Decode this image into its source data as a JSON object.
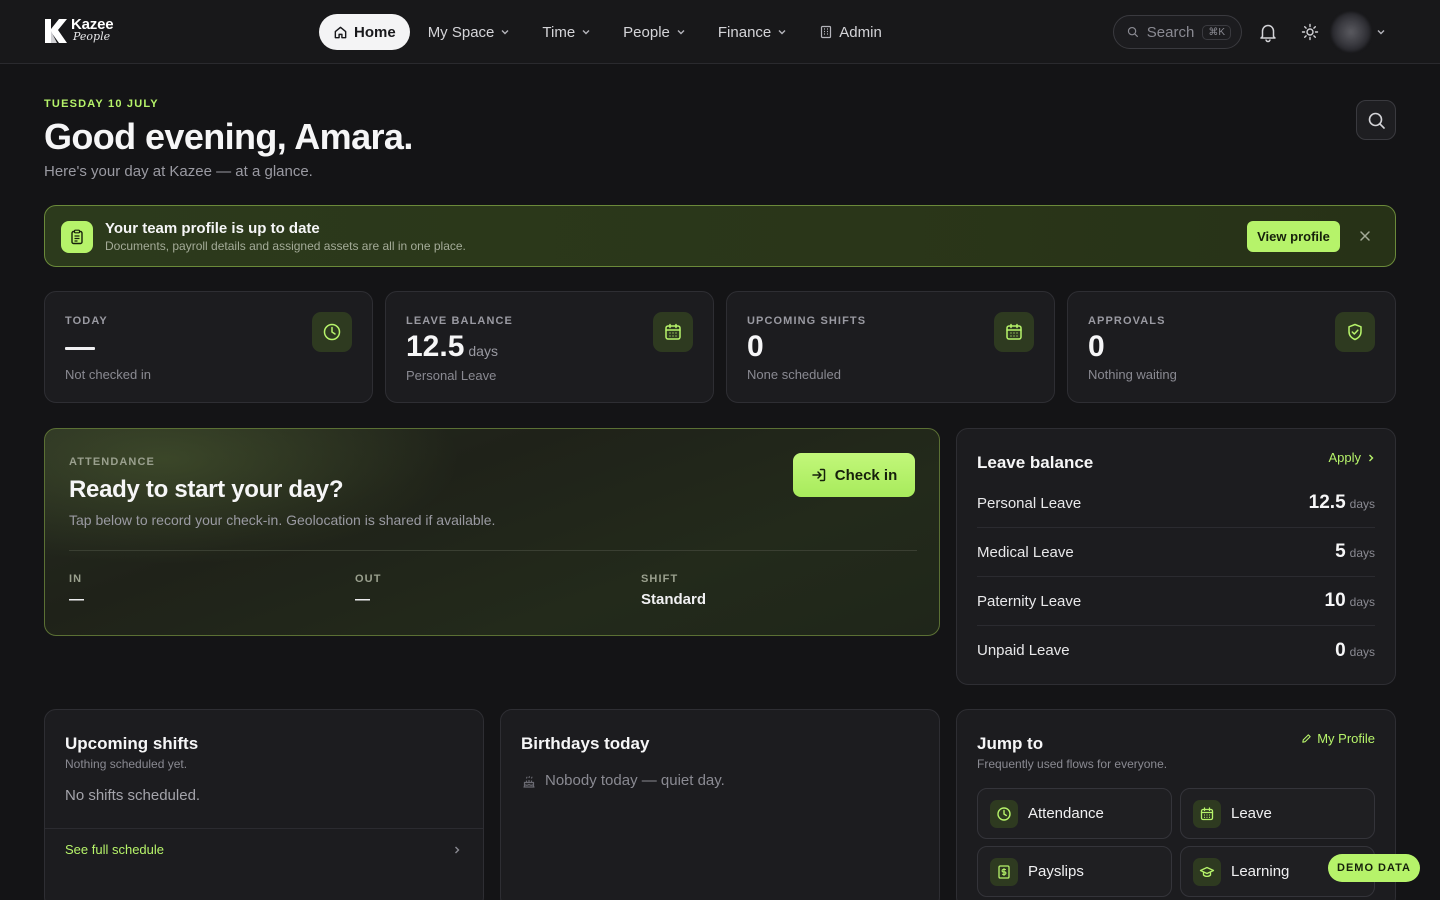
{
  "brand": {
    "name_line1": "Kazee",
    "name_line2": "People"
  },
  "nav": {
    "items": [
      {
        "label": "Home"
      },
      {
        "label": "My Space"
      },
      {
        "label": "Time"
      },
      {
        "label": "People"
      },
      {
        "label": "Finance"
      },
      {
        "label": "Admin"
      }
    ],
    "search_label": "Search",
    "search_shortcut": "⌘K"
  },
  "hero": {
    "date": "TUESDAY 10 JULY",
    "greeting": "Good evening, Amara.",
    "subtitle": "Here's your day at Kazee — at a glance."
  },
  "banner": {
    "title": "Your team profile is up to date",
    "text": "Documents, payroll details and assigned assets are all in one place.",
    "button": "View profile"
  },
  "stats": [
    {
      "label": "TODAY",
      "value": "",
      "unit": "",
      "note": "Not checked in",
      "icon": "clock-icon"
    },
    {
      "label": "LEAVE BALANCE",
      "value": "12.5",
      "unit": "days",
      "note": "Personal Leave",
      "icon": "calendar-icon"
    },
    {
      "label": "UPCOMING SHIFTS",
      "value": "0",
      "unit": "",
      "note": "None scheduled",
      "icon": "calendar-icon"
    },
    {
      "label": "APPROVALS",
      "value": "0",
      "unit": "",
      "note": "Nothing waiting",
      "icon": "shield-check-icon"
    }
  ],
  "attendance": {
    "label": "ATTENDANCE",
    "title": "Ready to start your day?",
    "description": "Tap below to record your check-in. Geolocation is shared if available.",
    "button": "Check in",
    "columns": [
      {
        "key": "IN",
        "value": "—"
      },
      {
        "key": "OUT",
        "value": "—"
      },
      {
        "key": "SHIFT",
        "value": "Standard"
      }
    ]
  },
  "leave_balance": {
    "title": "Leave balance",
    "action": "Apply",
    "rows": [
      {
        "name": "Personal Leave",
        "amount": "12.5",
        "unit": "days"
      },
      {
        "name": "Medical Leave",
        "amount": "5",
        "unit": "days"
      },
      {
        "name": "Paternity Leave",
        "amount": "10",
        "unit": "days"
      },
      {
        "name": "Unpaid Leave",
        "amount": "0",
        "unit": "days"
      }
    ]
  },
  "upcoming_shifts": {
    "title": "Upcoming shifts",
    "subtitle": "Nothing scheduled yet.",
    "empty": "No shifts scheduled.",
    "link": "See full schedule"
  },
  "birthdays": {
    "title": "Birthdays today",
    "empty": "Nobody today — quiet day."
  },
  "jump_to": {
    "title": "Jump to",
    "subtitle": "Frequently used flows for everyone.",
    "action": "My Profile",
    "tiles": [
      {
        "label": "Attendance",
        "icon": "clock-icon"
      },
      {
        "label": "Leave",
        "icon": "calendar-icon"
      },
      {
        "label": "Payslips",
        "icon": "dollar-receipt-icon"
      },
      {
        "label": "Learning",
        "icon": "graduation-cap-icon"
      }
    ]
  },
  "demo_badge": "DEMO DATA",
  "colors": {
    "accent": "#b6f36a",
    "background": "#141416",
    "card": "#1c1c1f"
  }
}
